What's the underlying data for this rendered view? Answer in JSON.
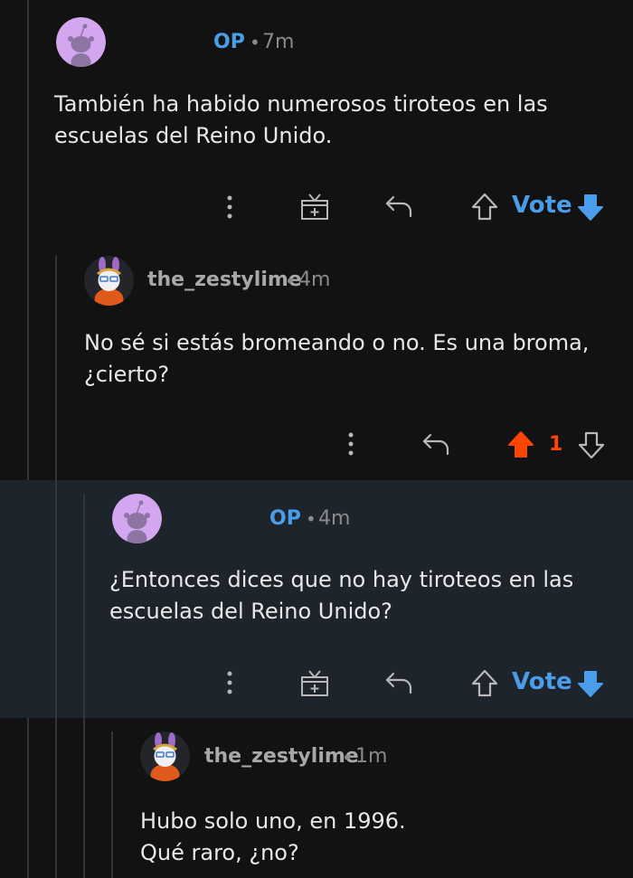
{
  "comments": [
    {
      "author": "OP",
      "separator": "•",
      "time": "7m",
      "body": "También ha habido numerosos tiroteos en las\nescuelas del Reino Unido.",
      "vote_label": "Vote"
    },
    {
      "author": "the_zestylime",
      "separator": "•",
      "time": "4m",
      "body": "No sé si estás bromeando o no. Es una broma,\n¿cierto?",
      "score": "1",
      "upvoted": true
    },
    {
      "author": "OP",
      "separator": "•",
      "time": "4m",
      "body": "¿Entonces dices que no hay tiroteos en las\nescuelas del Reino Unido?",
      "vote_label": "Vote"
    },
    {
      "author": "the_zestylime",
      "separator": "•",
      "time": "1m",
      "body": "Hubo solo uno, en 1996.\nQué raro, ¿no?"
    }
  ],
  "icons": {
    "more": "more-vertical-icon",
    "award": "award-gift-icon",
    "reply": "reply-icon",
    "upvote": "upvote-arrow-icon",
    "downvote": "downvote-arrow-icon"
  },
  "colors": {
    "background": "#121213",
    "highlight": "#1e242c",
    "op_blue": "#4a9de8",
    "upvote_orange": "#ff4500",
    "thread_line": "#343536"
  }
}
